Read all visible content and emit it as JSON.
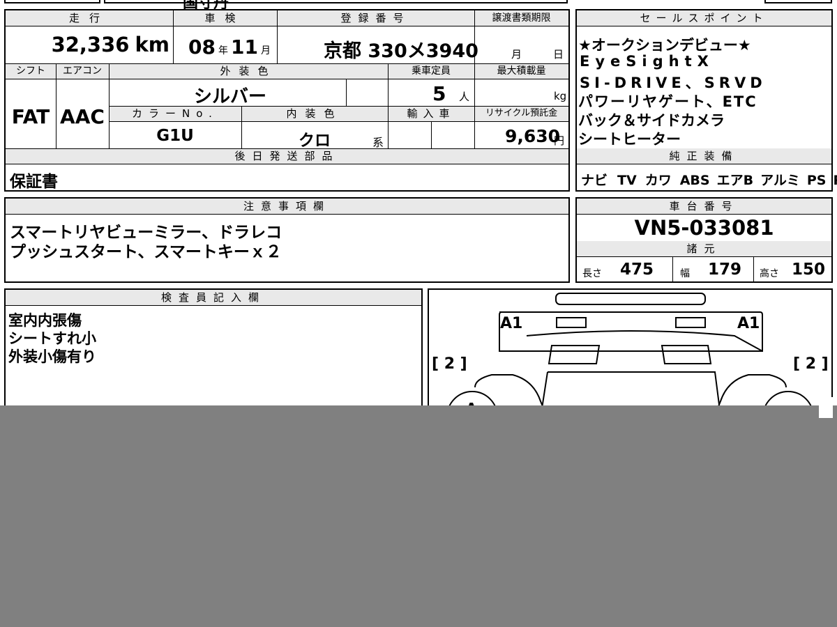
{
  "top_fragment": "国寸丹",
  "mileage": {
    "label": "走行",
    "value": "32,336",
    "unit": "km"
  },
  "shaken": {
    "label": "車検",
    "year": "08",
    "year_unit": "年",
    "month": "11",
    "month_unit": "月"
  },
  "registration": {
    "label": "登録番号",
    "value": "京都 330メ3940"
  },
  "transfer_docs": {
    "label": "譲渡書類期限",
    "month_unit": "月",
    "day_unit": "日"
  },
  "shift": {
    "label": "シフト",
    "value": "FAT"
  },
  "aircon": {
    "label": "エアコン",
    "value": "AAC"
  },
  "exterior_color": {
    "label": "外装色",
    "value": "シルバー"
  },
  "capacity": {
    "label": "乗車定員",
    "value": "5",
    "unit": "人"
  },
  "max_load": {
    "label": "最大積載量",
    "unit": "kg"
  },
  "color_no": {
    "label": "カラーNo.",
    "value": "G1U"
  },
  "interior_color": {
    "label": "内装色",
    "value": "クロ",
    "suffix": "系"
  },
  "import": {
    "label": "輸入車"
  },
  "recycle": {
    "label": "リサイクル預託金",
    "value": "9,630",
    "unit": "円"
  },
  "later_parts": {
    "label": "後日発送部品",
    "value": "保証書"
  },
  "sales_points": {
    "label": "セールスポイント",
    "lines": [
      "★オークションデビュー★",
      "EyeSightX",
      "SI-DRIVE、SRVD",
      "パワーリヤゲート、ETC",
      "バック＆サイドカメラ",
      "シートヒーター"
    ]
  },
  "standard_equipment": {
    "label": "純正装備",
    "items": [
      "ナビ",
      "TV",
      "カワ",
      "ABS",
      "エアB",
      "アルミ",
      "PS",
      "PW"
    ]
  },
  "notes": {
    "label": "注意事項欄",
    "lines": [
      "スマートリヤビューミラー、ドラレコ",
      "プッシュスタート、スマートキーｘ２"
    ]
  },
  "chassis_no": {
    "label": "車台番号",
    "value": "VN5-033081"
  },
  "specs": {
    "label": "諸元",
    "length_label": "長さ",
    "length": "475",
    "width_label": "幅",
    "width": "179",
    "height_label": "高さ",
    "height": "150"
  },
  "inspector": {
    "label": "検査員記入欄",
    "lines": [
      "室内内張傷",
      "シートすれ小",
      "外装小傷有り"
    ]
  },
  "diagram": {
    "mark_a1_left": "A1",
    "mark_a1_right": "A1",
    "mark_2_left": "[ 2 ]",
    "mark_2_right": "[ 2 ]",
    "mark_a": "A"
  }
}
